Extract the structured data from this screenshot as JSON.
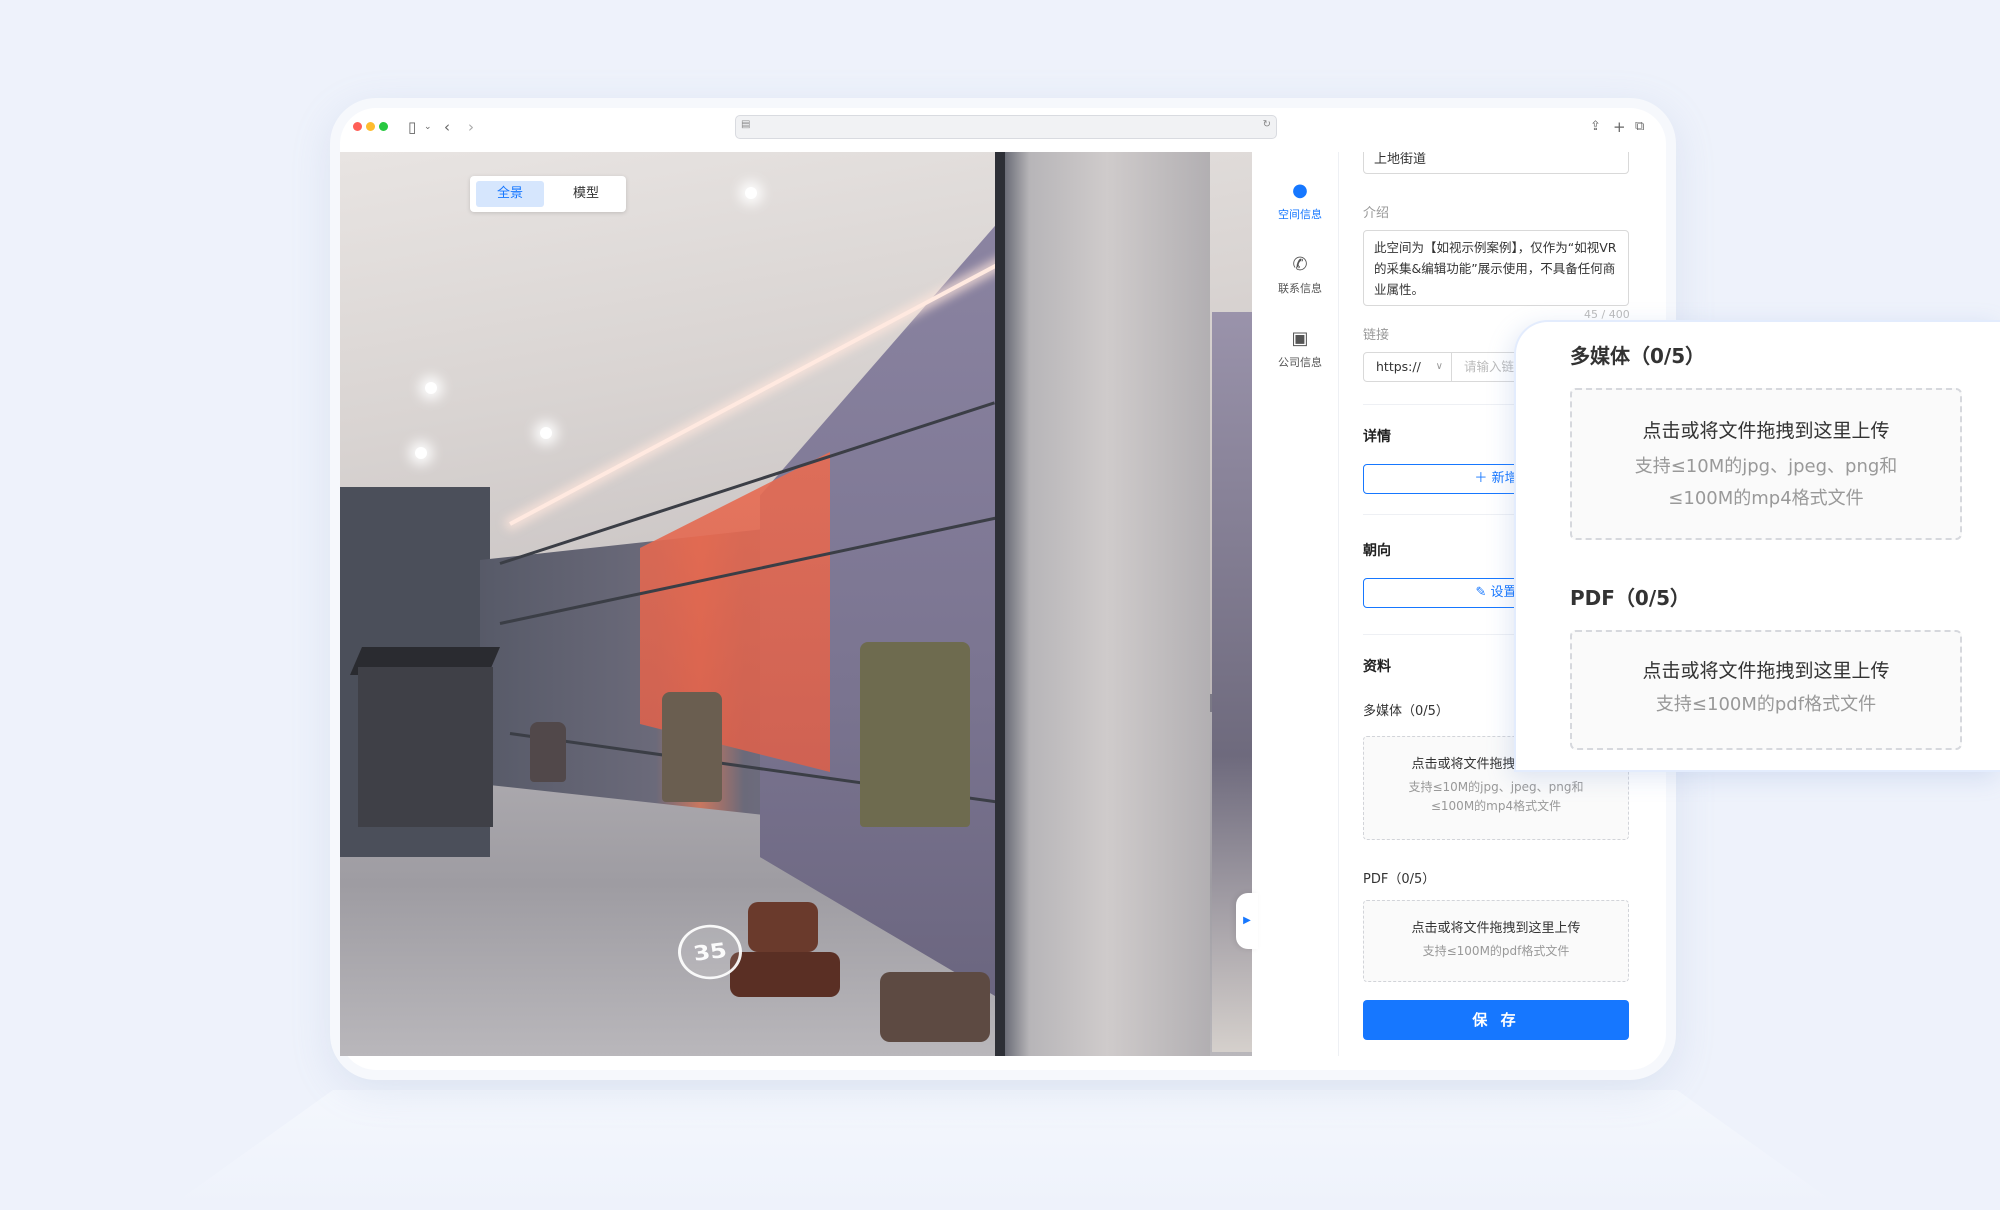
{
  "browser": {
    "icons": [
      "sidebar-icon",
      "chevron-down-icon",
      "back-icon",
      "forward-icon",
      "share-icon",
      "new-tab-icon",
      "tabs-icon",
      "reload-icon",
      "page-icon"
    ]
  },
  "view_toggle": {
    "panorama_label": "全景",
    "model_label": "模型",
    "active": "全景"
  },
  "panorama": {
    "marker_number": "35"
  },
  "side_nav": {
    "items": [
      {
        "label": "空间信息",
        "icon": "chat-bubble-icon",
        "active": true
      },
      {
        "label": "联系信息",
        "icon": "phone-icon",
        "active": false
      },
      {
        "label": "公司信息",
        "icon": "briefcase-icon",
        "active": false
      }
    ]
  },
  "form": {
    "address_value": "上地街道",
    "intro_label": "介绍",
    "intro_value": "此空间为【如视示例案例】，仅作为“如视VR的采集&编辑功能”展示使用，不具备任何商业属性。",
    "intro_count": "45 / 400",
    "link_label": "链接",
    "link_protocol": "https://",
    "link_placeholder": "请输入链接",
    "details_title": "详情",
    "details_add_label": "新增",
    "orientation_title": "朝向",
    "orientation_set_label": "设置",
    "materials_title": "资料",
    "media_label": "多媒体（0/5）",
    "media_drop_title": "点击或将文件拖拽到这里上传",
    "media_drop_hint1": "支持≤10M的jpg、jpeg、png和",
    "media_drop_hint2": "≤100M的mp4格式文件",
    "pdf_label": "PDF（0/5）",
    "pdf_drop_title": "点击或将文件拖拽到这里上传",
    "pdf_drop_hint": "支持≤100M的pdf格式文件",
    "save_label": "保 存"
  },
  "zoom_card": {
    "media_label": "多媒体（0/5）",
    "media_drop_title": "点击或将文件拖拽到这里上传",
    "media_drop_hint1": "支持≤10M的jpg、jpeg、png和",
    "media_drop_hint2": "≤100M的mp4格式文件",
    "pdf_label": "PDF（0/5）",
    "pdf_drop_title": "点击或将文件拖拽到这里上传",
    "pdf_drop_hint": "支持≤100M的pdf格式文件"
  },
  "colors": {
    "accent": "#1677ff",
    "toggle_active_bg": "#d6e6fd",
    "background": "#eef2fb"
  }
}
